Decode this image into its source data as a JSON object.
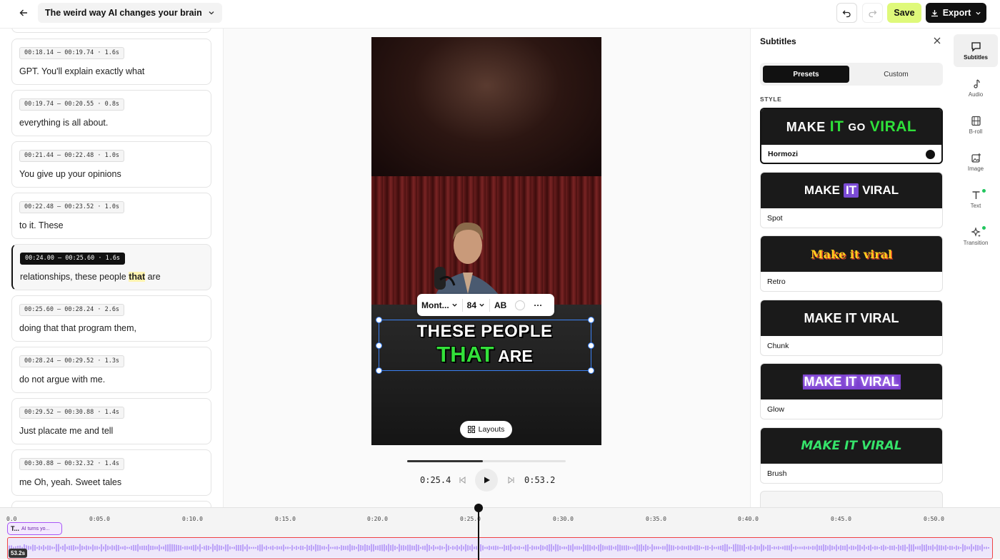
{
  "header": {
    "title": "The weird way AI changes your brain",
    "save_label": "Save",
    "export_label": "Export"
  },
  "transcript": [
    {
      "time": "00:18.14 – 00:19.74 · 1.6s",
      "text": "GPT. You'll explain exactly what"
    },
    {
      "time": "00:19.74 – 00:20.55 · 0.8s",
      "text": "everything is all about."
    },
    {
      "time": "00:21.44 – 00:22.48 · 1.0s",
      "text": "You give up your opinions"
    },
    {
      "time": "00:22.48 – 00:23.52 · 1.0s",
      "text": "to it. These"
    },
    {
      "time": "00:24.00 – 00:25.60 · 1.6s",
      "text_before": "relationships, these people ",
      "highlight": "that",
      "text_after": " are",
      "active": true
    },
    {
      "time": "00:25.60 – 00:28.24 · 2.6s",
      "text": "doing that that program them,"
    },
    {
      "time": "00:28.24 – 00:29.52 · 1.3s",
      "text": "do not argue with me."
    },
    {
      "time": "00:29.52 – 00:30.88 · 1.4s",
      "text": "Just placate me and tell"
    },
    {
      "time": "00:30.88 – 00:32.32 · 1.4s",
      "text": "me Oh, yeah. Sweet tales"
    }
  ],
  "caption": {
    "line1": "THESE PEOPLE",
    "highlight_word": "THAT",
    "line2_rest": "ARE"
  },
  "format_toolbar": {
    "font": "Mont...",
    "size": "84",
    "case": "AB",
    "more": "···"
  },
  "preview": {
    "layouts_label": "Layouts",
    "current_time": "0:25.4",
    "total_time": "0:53.2",
    "progress": 0.477
  },
  "subtitles_panel": {
    "title": "Subtitles",
    "tabs": [
      "Presets",
      "Custom"
    ],
    "active_tab": "Presets",
    "section_label": "STYLE",
    "styles": [
      {
        "name": "Hormozi",
        "selected": true
      },
      {
        "name": "Spot"
      },
      {
        "name": "Retro",
        "preview": "Make it viral"
      },
      {
        "name": "Chunk",
        "preview": "MAKE IT VIRAL"
      },
      {
        "name": "Glow",
        "preview": "MAKE IT VIRAL"
      },
      {
        "name": "Brush",
        "preview": "MAKE IT VIRAL"
      }
    ],
    "hormozi_preview": [
      "MAKE",
      "IT",
      "GO",
      "VIRAL"
    ],
    "spot_preview": [
      "MAKE",
      "IT",
      "VIRAL"
    ]
  },
  "rail": [
    {
      "label": "Subtitles",
      "icon": "subtitles-icon",
      "active": true
    },
    {
      "label": "Audio",
      "icon": "music-note-icon"
    },
    {
      "label": "B-roll",
      "icon": "film-icon"
    },
    {
      "label": "Image",
      "icon": "image-icon"
    },
    {
      "label": "Text",
      "icon": "text-icon",
      "dot": true
    },
    {
      "label": "Transition",
      "icon": "sparkle-icon",
      "dot": true
    }
  ],
  "timeline": {
    "ticks": [
      "0.0",
      "0:05.0",
      "0:10.0",
      "0:15.0",
      "0:20.0",
      "0:25.0",
      "0:30.0",
      "0:35.0",
      "0:40.0",
      "0:45.0",
      "0:50.0"
    ],
    "clip_prefix": "T...",
    "clip_label": "AI turns yo...",
    "duration_badge": "53.2s"
  },
  "colors": {
    "accent_save": "#dff97a",
    "selection": "#3b82f6",
    "caption_highlight": "#33e03a",
    "clip_border": "#a855f7",
    "audio_border": "#ef4444"
  }
}
